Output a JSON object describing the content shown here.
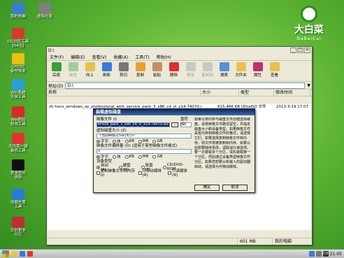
{
  "desktop": {
    "icons": [
      {
        "label": "我的电脑",
        "color": "#3a7bd5"
      },
      {
        "label": "虚拟光驱",
        "color": "#7f7f7f"
      },
      {
        "label": "DG分区工具\n【64位】",
        "color": "#d83a2a"
      },
      {
        "label": "GHOST\n备份恢复",
        "color": "#e8c010"
      },
      {
        "label": "Win系统\n安装工具",
        "color": "#2a9fd8"
      },
      {
        "label": "Win密码\n修改工具",
        "color": "#d82a2a"
      },
      {
        "label": "大白菜一键\n装机工具",
        "color": "#e83030"
      },
      {
        "label": "登录密码\n清除",
        "color": "#111111"
      },
      {
        "label": "加载外置\n工具",
        "color": "#2a7bd8"
      },
      {
        "label": "识别更多\n分区",
        "color": "#c03030"
      }
    ],
    "brand": {
      "name": "大白菜",
      "sub": "DaBaiCai"
    }
  },
  "explorer": {
    "title": "D:\\",
    "menu": [
      "文件(F)",
      "编辑(E)",
      "查看(V)",
      "收藏(A)",
      "工具(T)",
      "帮助(H)"
    ],
    "toolbar": [
      {
        "label": "后退",
        "icon": "back-arrow-icon",
        "color": "#3a9f3a",
        "disabled": false
      },
      {
        "label": "前进",
        "icon": "forward-arrow-icon",
        "color": "#3a9f3a",
        "disabled": true
      },
      {
        "label": "向上",
        "icon": "up-folder-icon",
        "color": "#e8c050",
        "disabled": false
      },
      {
        "label": "刷新",
        "icon": "refresh-icon",
        "color": "#3a7bd5",
        "disabled": false
      },
      {
        "label": "剪切",
        "icon": "cut-icon",
        "color": "#777777",
        "disabled": false
      },
      {
        "label": "复制",
        "icon": "copy-icon",
        "color": "#e8a030",
        "disabled": false
      },
      {
        "label": "粘贴",
        "icon": "paste-icon",
        "color": "#c09060",
        "disabled": false
      },
      {
        "label": "删除",
        "icon": "delete-icon",
        "color": "#d83030",
        "disabled": false
      },
      {
        "label": "移至",
        "icon": "move-to-icon",
        "color": "#999999",
        "disabled": true
      },
      {
        "label": "复制到",
        "icon": "copy-to-icon",
        "color": "#999999",
        "disabled": true
      },
      {
        "label": "搜索",
        "icon": "search-icon",
        "color": "#5a8fd5",
        "disabled": false
      },
      {
        "label": "文件夹",
        "icon": "folders-icon",
        "color": "#e8c050",
        "disabled": false
      },
      {
        "label": "属性",
        "icon": "properties-icon",
        "color": "#c03070",
        "disabled": false
      },
      {
        "label": "查看",
        "icon": "view-icon",
        "color": "#e8c050",
        "disabled": false
      }
    ],
    "address_label": "地址(D)",
    "address_value": "D:\\",
    "columns": [
      "名称",
      "大小",
      "类型",
      "修改时间"
    ],
    "files": [
      {
        "name": "zh-hans_windows_xp_professional_with_service_pack_3_x86_cd_vl_x14-74070.iso",
        "size": "615,466 KB",
        "type": "UltraISO 文件",
        "modified": "2013-3-19 17:07"
      }
    ],
    "status": {
      "size": "601 MB",
      "location": "我的电脑"
    }
  },
  "dialog": {
    "title": "装载虚拟磁盘",
    "image_label": "映像文件 (I)",
    "image_value": "ervice_pack_3_x86_cd_vl_x14-74070.iso",
    "drive_label": "盘符 (D)",
    "drive_value": "G",
    "vsize_label": "虚拟磁盘大小 (Z)",
    "vsize_value": "《当前映像文件的大小》",
    "units": [
      "字节",
      "块",
      "KB",
      "MB",
      "GB"
    ],
    "offset_label": "映像文件偏移量 (O)  (适用于某些映像文件格式)",
    "offset_value": "0",
    "devtype_label": "设备类型",
    "devtypes": [
      "自动 (A)",
      "硬盘 (H)",
      "软盘 (F)",
      "CD/DVD-ROM"
    ],
    "checks": [
      "复制映像文件到内存 (I)",
      "可移动媒体 (R)",
      "只读媒体 (R)"
    ],
    "help": "如果以将内存与磁盘文件创建虚拟磁盘，请将映像文件路径留空，并指定磁盘大小和设备类型。如果映像文件具有内存和映像文件的格式，请选择它们。如果选择复制映像文件到内存，则文件将被复制到内存。如果以后想要储存更改，请取消只读选项。要一次装载多个分区，请先装载第一个分区，然后通过设备类型映像文件分区。如果您想要从新装入的驱动器启动，请选择为可移动媒体。",
    "ok": "确定",
    "cancel": "取消"
  },
  "taskbar": {
    "clock": "21:05",
    "tray_ch": "CH"
  }
}
